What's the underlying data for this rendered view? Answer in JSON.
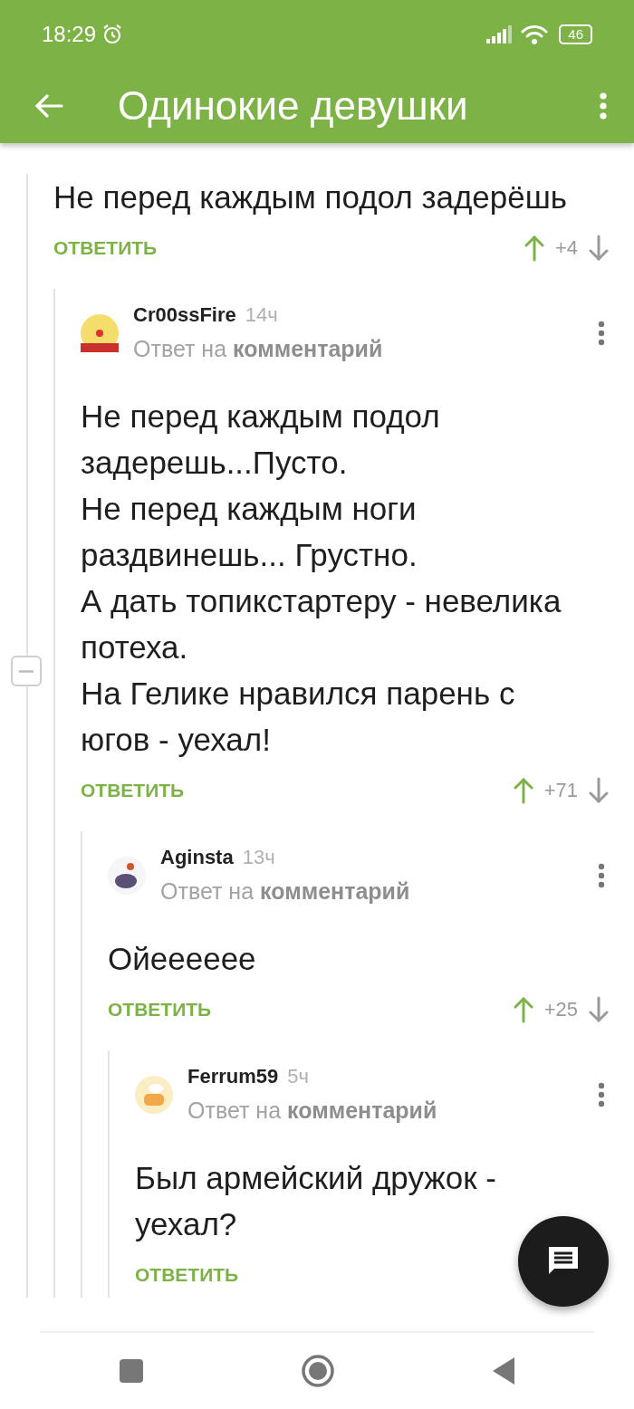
{
  "status_bar": {
    "time": "18:29",
    "battery": "46"
  },
  "toolbar": {
    "title": "Одинокие девушки"
  },
  "comments": [
    {
      "text": "Не перед каждым подол задерёшь",
      "reply_label": "ОТВЕТИТЬ",
      "score": "+4",
      "expanded": true,
      "children": [
        {
          "author": "Cr00ssFire",
          "time": "14ч",
          "reply_to": "Ответ на **комментарий**",
          "text": "Не перед каждым подол задерешь...Пусто.\nНе перед каждым ноги раздвинешь... Грустно.\nА дать топикстартеру - невелика потеха.\nНа Гелике нравился парень с югов - уехал!",
          "reply_label": "ОТВЕТИТЬ",
          "score": "+71",
          "children": [
            {
              "author": "Aginsta",
              "time": "13ч",
              "reply_to": "Ответ на **комментарий**",
              "text": "Ойееееее",
              "reply_label": "ОТВЕТИТЬ",
              "score": "+25",
              "children": [
                {
                  "author": "Ferrum59",
                  "time": "5ч",
                  "reply_to": "Ответ на **комментарий**",
                  "text": "Был армейский дружок - уехал?",
                  "reply_label": "ОТВЕТИТЬ"
                }
              ]
            }
          ]
        }
      ]
    }
  ]
}
